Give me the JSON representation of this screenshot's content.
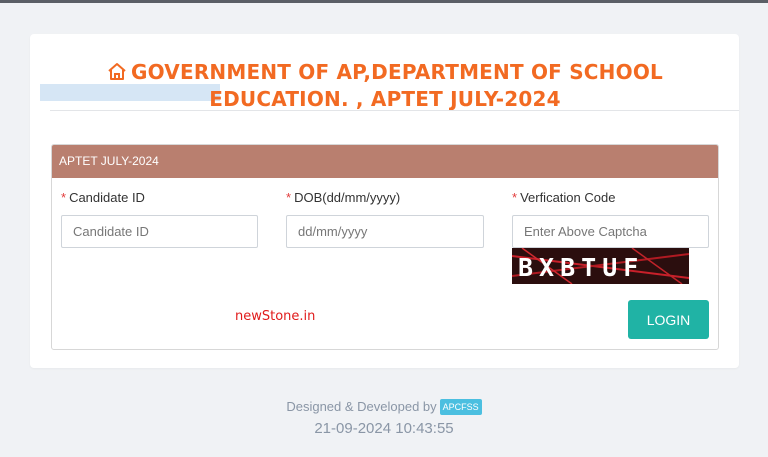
{
  "header": {
    "title_line1": "GOVERNMENT OF AP,DEPARTMENT OF SCHOOL",
    "title_line2": "EDUCATION. , APTET JULY-2024",
    "icon": "home-icon"
  },
  "panel": {
    "heading": "APTET JULY-2024",
    "fields": {
      "candidate_id": {
        "label": "Candidate ID",
        "placeholder": "Candidate ID"
      },
      "dob": {
        "label": "DOB(dd/mm/yyyy)",
        "placeholder": "dd/mm/yyyy"
      },
      "verification": {
        "label": "Verfication Code",
        "placeholder": "Enter Above Captcha"
      }
    },
    "required_mark": "*",
    "captcha_text": "BXBTUF",
    "watermark": "newStone.in",
    "login_label": "LOGIN"
  },
  "footer": {
    "designed_by": "Designed & Developed by",
    "badge": "APCFSS",
    "timestamp": "21-09-2024 10:43:55"
  },
  "colors": {
    "title": "#f26a22",
    "panel_header": "#b97f6f",
    "login_button": "#20b3a5",
    "required": "#e23b3b"
  }
}
